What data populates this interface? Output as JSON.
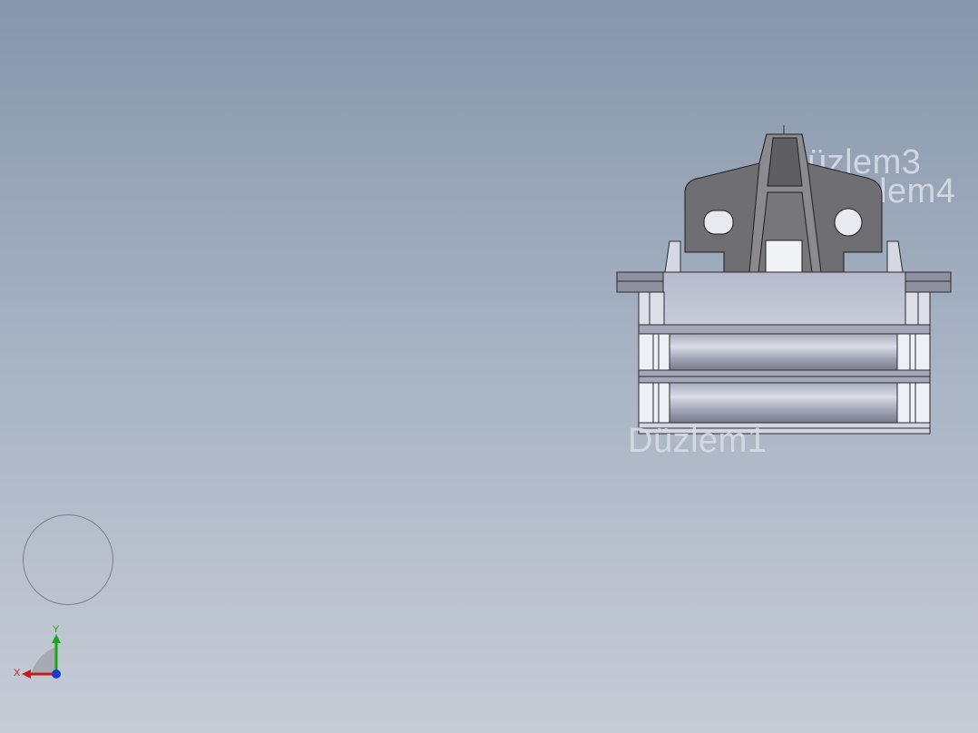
{
  "viewport": {
    "planes": {
      "plane3": "Düzlem3",
      "plane4": "Düzlem4",
      "plane1": "Düzlem1"
    },
    "triad": {
      "x_label": "X",
      "y_label": "Y"
    },
    "colors": {
      "background_top": "#8796ab",
      "background_bottom": "#c6ccd6",
      "part_dark": "#6e6e72",
      "part_light": "#c7cad6",
      "x_axis": "#cc1a1a",
      "y_axis": "#1aa61a",
      "z_axis": "#1a3acc"
    }
  }
}
